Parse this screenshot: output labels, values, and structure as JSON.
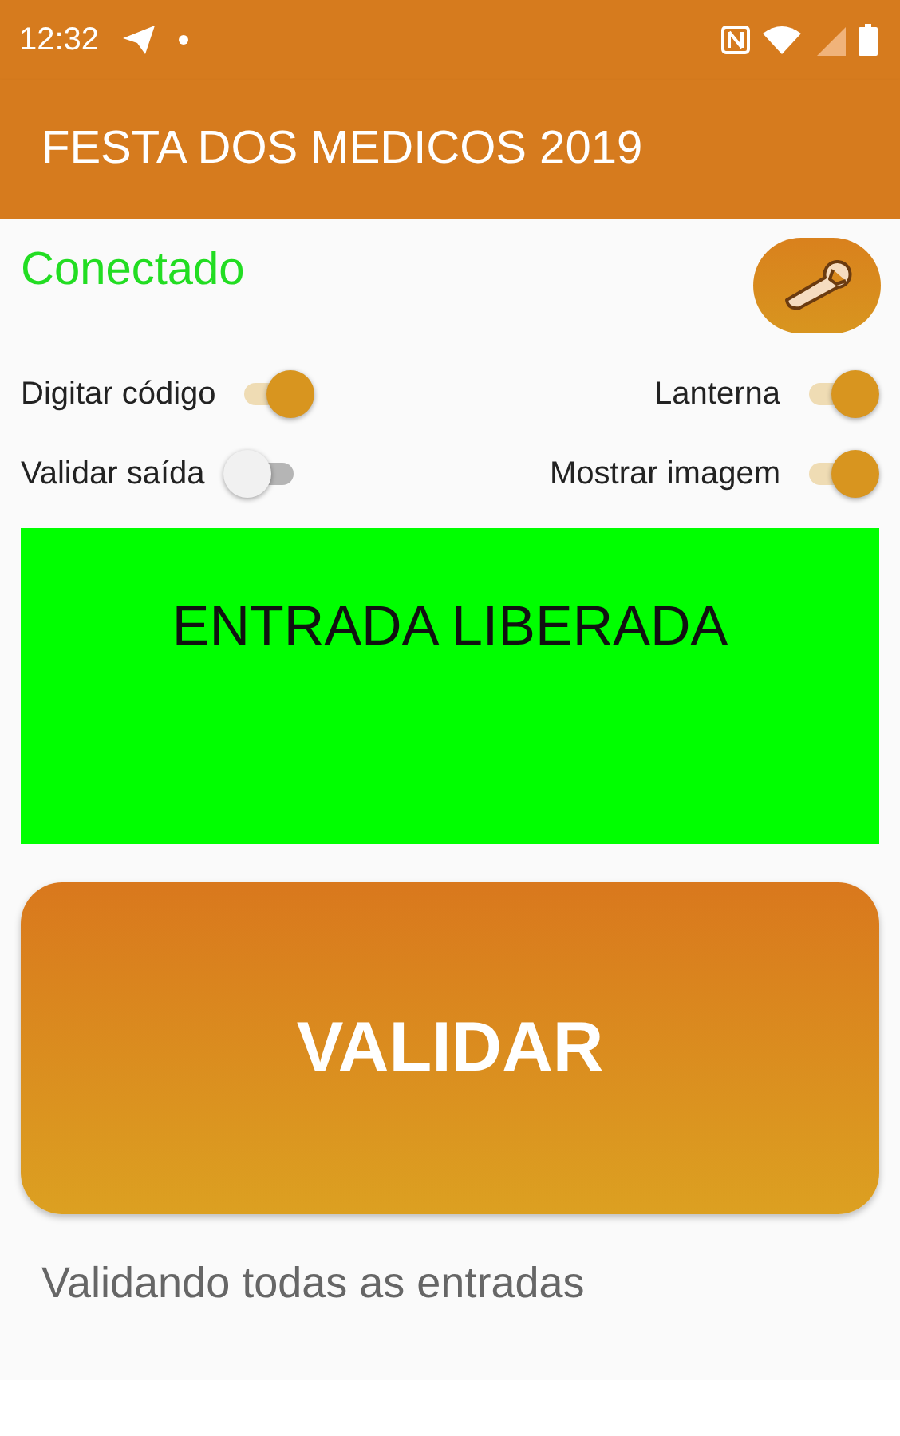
{
  "status_bar": {
    "time": "12:32"
  },
  "app_bar": {
    "title": "FESTA DOS MEDICOS 2019"
  },
  "connection": {
    "label": "Conectado"
  },
  "switches": [
    {
      "label": "Digitar código",
      "on": true,
      "kind": "left"
    },
    {
      "label": "Lanterna",
      "on": true,
      "kind": "right"
    },
    {
      "label": "Validar saída",
      "on": false,
      "kind": "left"
    },
    {
      "label": "Mostrar imagem",
      "on": true,
      "kind": "right"
    }
  ],
  "result": {
    "message": "ENTRADA LIBERADA",
    "color": "#00ff00"
  },
  "validate_button": {
    "label": "VALIDAR"
  },
  "footer": {
    "text": "Validando todas as entradas"
  }
}
